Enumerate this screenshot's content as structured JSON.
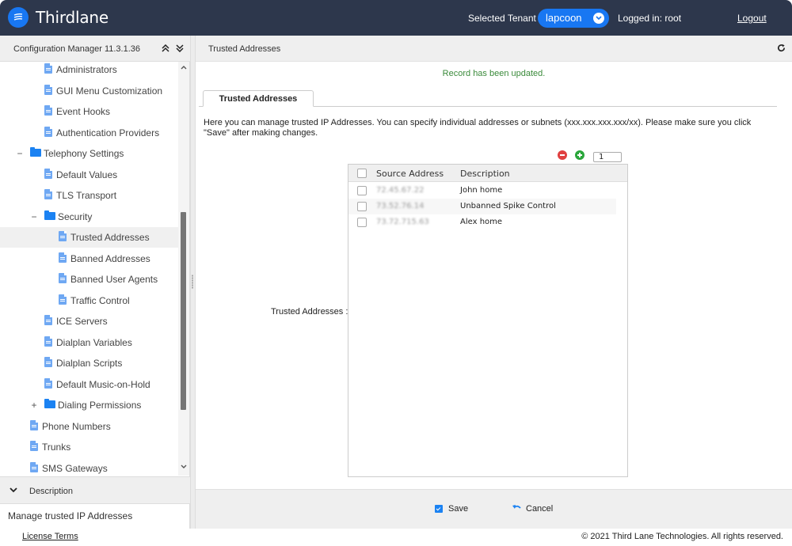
{
  "header": {
    "brand": "Thirdlane",
    "tenant_label": "Selected Tenant :",
    "tenant_value": "lapcoon",
    "logged_in": "Logged in: root",
    "logout": "Logout"
  },
  "left_panel": {
    "title": "Configuration Manager 11.3.1.36",
    "collapse_all_icon": "⌃",
    "expand_all_icon": "⌄",
    "tree": [
      {
        "label": "Administrators",
        "type": "doc",
        "level": 2
      },
      {
        "label": "GUI Menu Customization",
        "type": "doc",
        "level": 2
      },
      {
        "label": "Event Hooks",
        "type": "doc",
        "level": 2
      },
      {
        "label": "Authentication Providers",
        "type": "doc",
        "level": 2
      },
      {
        "label": "Telephony Settings",
        "type": "folder",
        "level": 1,
        "toggle": "−"
      },
      {
        "label": "Default Values",
        "type": "doc",
        "level": 2
      },
      {
        "label": "TLS Transport",
        "type": "doc",
        "level": 2
      },
      {
        "label": "Security",
        "type": "folder",
        "level": 2,
        "toggle": "−"
      },
      {
        "label": "Trusted Addresses",
        "type": "doc",
        "level": 3,
        "selected": true
      },
      {
        "label": "Banned Addresses",
        "type": "doc",
        "level": 3
      },
      {
        "label": "Banned User Agents",
        "type": "doc",
        "level": 3
      },
      {
        "label": "Traffic Control",
        "type": "doc",
        "level": 3
      },
      {
        "label": "ICE Servers",
        "type": "doc",
        "level": 2
      },
      {
        "label": "Dialplan Variables",
        "type": "doc",
        "level": 2
      },
      {
        "label": "Dialplan Scripts",
        "type": "doc",
        "level": 2
      },
      {
        "label": "Default Music-on-Hold",
        "type": "doc",
        "level": 2
      },
      {
        "label": "Dialing Permissions",
        "type": "folder",
        "level": 2,
        "toggle": "+"
      },
      {
        "label": "Phone Numbers",
        "type": "doc",
        "level": 1
      },
      {
        "label": "Trunks",
        "type": "doc",
        "level": 1
      },
      {
        "label": "SMS Gateways",
        "type": "doc",
        "level": 1
      }
    ],
    "description_header": "Description",
    "description_text": "Manage trusted IP Addresses"
  },
  "main": {
    "title": "Trusted Addresses",
    "status_message": "Record has been updated.",
    "tab_label": "Trusted Addresses",
    "intro": "Here you can manage trusted IP Addresses. You can specify individual addresses or subnets (xxx.xxx.xxx.xxx/xx). Please make sure you click \"Save\" after making changes.",
    "field_label": "Trusted Addresses :",
    "count_value": "1",
    "grid": {
      "columns": [
        "Source Address",
        "Description"
      ],
      "rows": [
        {
          "address": "72.45.67.22",
          "description": "John home"
        },
        {
          "address": "73.52.76.14",
          "description": "Unbanned Spike Control"
        },
        {
          "address": "73.72.715.63",
          "description": "Alex home"
        }
      ]
    },
    "save_label": "Save",
    "cancel_label": "Cancel"
  },
  "footer": {
    "license": "License Terms",
    "copyright": "© 2021 Third Lane Technologies. All rights reserved."
  }
}
